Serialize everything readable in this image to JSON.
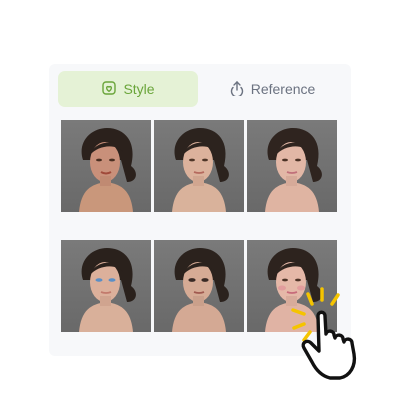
{
  "tabs": [
    {
      "label": "Style",
      "icon": "style-icon",
      "active": true
    },
    {
      "label": "Reference",
      "icon": "upload-icon",
      "active": false
    }
  ],
  "colors": {
    "active_tab_bg": "#e5f2d6",
    "active_tab_text": "#6aa53a",
    "inactive_tab_text": "#6b7280",
    "panel_bg": "#f7f8fa",
    "hand_accent": "#f5c400"
  },
  "gallery": {
    "items": [
      {
        "style": "warm-bronze-makeup"
      },
      {
        "style": "natural-glow"
      },
      {
        "style": "soft-rose"
      },
      {
        "style": "blue-eyeliner"
      },
      {
        "style": "smoky-eye"
      },
      {
        "style": "pink-blush"
      }
    ]
  }
}
